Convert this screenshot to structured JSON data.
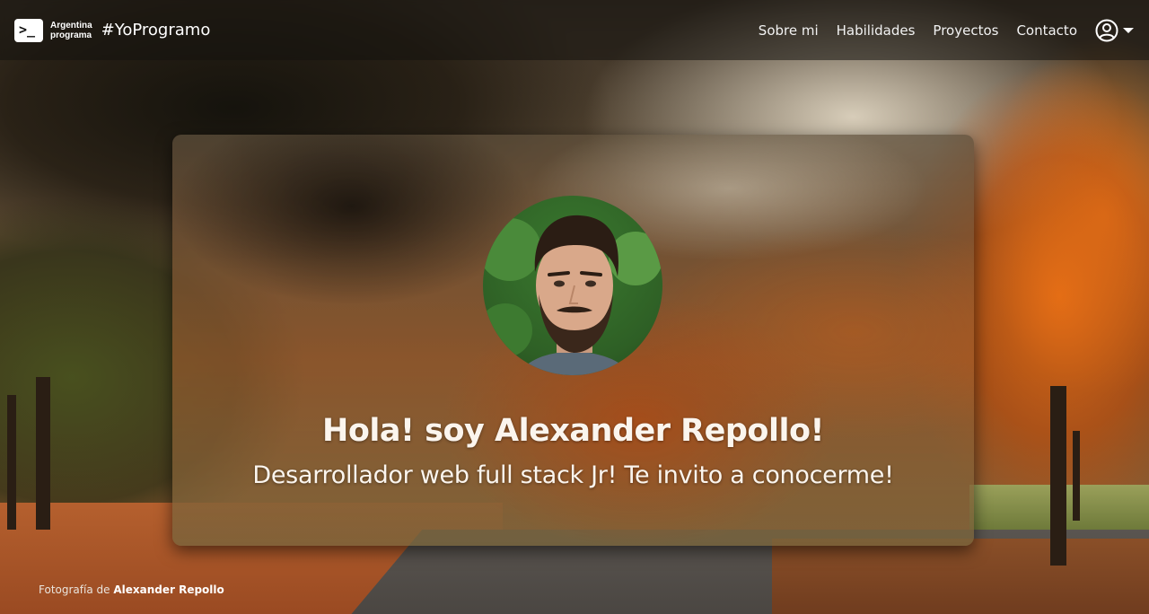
{
  "navbar": {
    "logo_line1": "Argentina",
    "logo_line2": "programa",
    "logo_prompt": ">_",
    "hashtag": "#YoProgramo",
    "links": [
      "Sobre mi",
      "Habilidades",
      "Proyectos",
      "Contacto"
    ],
    "user_icon": "user-circle-icon",
    "caret_icon": "caret-down-icon"
  },
  "hero": {
    "title": "Hola! soy Alexander Repollo!",
    "subtitle": "Desarrollador web full stack Jr! Te invito a conocerme!"
  },
  "credit": {
    "prefix": "Fotografía de",
    "author": "Alexander Repollo"
  },
  "colors": {
    "accent_orange": "#e86e14",
    "text_light": "#fbf5ee"
  }
}
